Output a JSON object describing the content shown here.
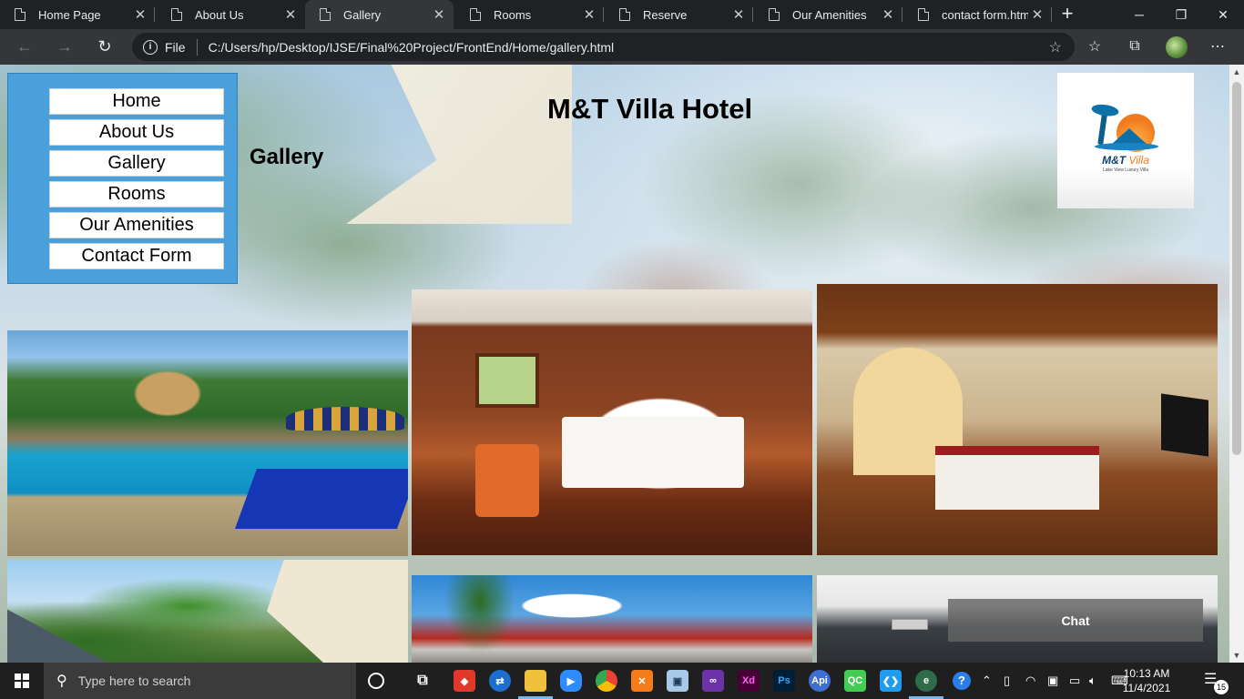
{
  "browser": {
    "tabs": [
      {
        "label": "Home Page"
      },
      {
        "label": "About Us"
      },
      {
        "label": "Gallery"
      },
      {
        "label": "Rooms"
      },
      {
        "label": "Reserve"
      },
      {
        "label": "Our Amenities"
      },
      {
        "label": "contact form.html"
      }
    ],
    "active_tab_index": 2,
    "scheme_label": "File",
    "url": "C:/Users/hp/Desktop/IJSE/Final%20Project/FrontEnd/Home/gallery.html"
  },
  "page": {
    "hotel_title": "M&T Villa Hotel",
    "section_title": "Gallery",
    "nav": [
      {
        "label": "Home"
      },
      {
        "label": "About Us"
      },
      {
        "label": "Gallery"
      },
      {
        "label": "Rooms"
      },
      {
        "label": "Our Amenities"
      },
      {
        "label": "Contact Form"
      }
    ],
    "logo": {
      "brand": "M&T",
      "brand_suffix": "Villa",
      "tagline": "Lake View Luxury Villa"
    },
    "gallery_images": [
      {
        "name": "pool-photo"
      },
      {
        "name": "bedroom-photo"
      },
      {
        "name": "suite-photo"
      },
      {
        "name": "garden-photo"
      },
      {
        "name": "resort-photo"
      },
      {
        "name": "modern-room-photo"
      }
    ],
    "chat_label": "Chat"
  },
  "taskbar": {
    "search_placeholder": "Type here to search",
    "time": "10:13 AM",
    "date": "11/4/2021",
    "notification_count": "15"
  },
  "colors": {
    "nav_panel": "#4aa0da",
    "browser_bg": "#202124",
    "toolbar_bg": "#35363a"
  }
}
